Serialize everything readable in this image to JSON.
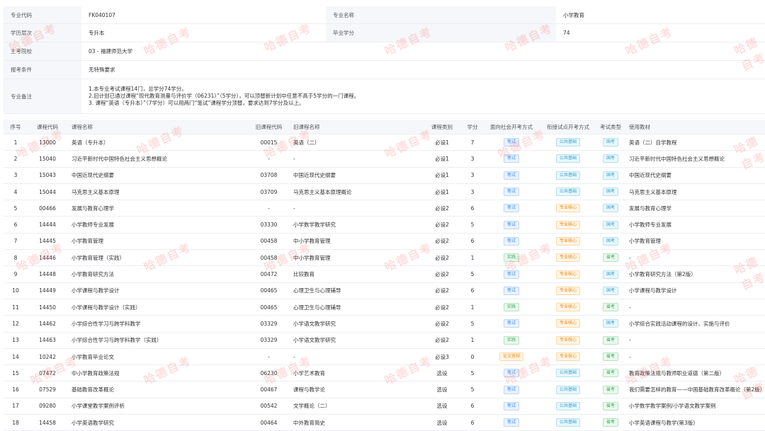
{
  "info": {
    "code_label": "专业代码",
    "code_value": "FK040107",
    "name_label": "专业名称",
    "name_value": "小学教育",
    "level_label": "学历层次",
    "level_value": "专升本",
    "credits_label": "毕业学分",
    "credits_value": "74",
    "school_label": "主考院校",
    "school_value": "03 - 福建师范大学",
    "cond_label": "报考条件",
    "cond_value": "无特殊要求",
    "notes_label": "专业备注",
    "notes": [
      "1.本专业考试课程14门，总学分74学分。",
      "2.旧计划已通过课程“现代教育测量与评价学（06231）”（5学分），可以顶替新计划中任意不高于5学分的一门课程。",
      "3. 课程“英语（专升本）”（7学分）可以用两门“笔试”课程学分顶替，要求达到7学分及以上。"
    ]
  },
  "headers": [
    "序号",
    "课程代码",
    "课程名称",
    "旧课程代码",
    "旧课程名称",
    "课程类别",
    "学分",
    "面向社会开考方式",
    "衔接试点开考方式",
    "考试类型",
    "使用教材"
  ],
  "rows": [
    {
      "no": "1",
      "code": "13000",
      "name": "英语（专升本）",
      "old_code": "00015",
      "old_name": "英语（二）",
      "cat": "必设1",
      "credit": "7",
      "social": "笔试",
      "social_c": "blue",
      "pilot": "公共基础",
      "pilot_c": "cyan",
      "exam": "国考",
      "book": "英语（二）自学教程"
    },
    {
      "no": "2",
      "code": "15040",
      "name": "习近平新时代中国特色社会主义思想概论",
      "old_code": "-",
      "old_name": "-",
      "cat": "必设1",
      "credit": "3",
      "social": "笔试",
      "social_c": "blue",
      "pilot": "公共基础",
      "pilot_c": "cyan",
      "exam": "国考",
      "book": "习近平新时代中国特色社会主义思想概论"
    },
    {
      "no": "3",
      "code": "15043",
      "name": "中国近现代史纲要",
      "old_code": "03708",
      "old_name": "中国近现代史纲要",
      "cat": "必设1",
      "credit": "3",
      "social": "笔试",
      "social_c": "blue",
      "pilot": "公共基础",
      "pilot_c": "cyan",
      "exam": "国考",
      "book": "中国近现代史纲要"
    },
    {
      "no": "4",
      "code": "15044",
      "name": "马克思主义基本原理",
      "old_code": "03709",
      "old_name": "马克思主义基本原理概论",
      "cat": "必设1",
      "credit": "3",
      "social": "笔试",
      "social_c": "blue",
      "pilot": "公共基础",
      "pilot_c": "cyan",
      "exam": "国考",
      "book": "马克思主义基本原理"
    },
    {
      "no": "5",
      "code": "00466",
      "name": "发展与教育心理学",
      "old_code": "-",
      "old_name": "-",
      "cat": "必设2",
      "credit": "6",
      "social": "笔试",
      "social_c": "blue",
      "pilot": "专业核心",
      "pilot_c": "orange",
      "exam": "国考",
      "book": "发展与教育心理学"
    },
    {
      "no": "6",
      "code": "14444",
      "name": "小学教师专业发展",
      "old_code": "03330",
      "old_name": "小学数学教学研究",
      "cat": "必设2",
      "credit": "5",
      "social": "笔试",
      "social_c": "blue",
      "pilot": "专业核心",
      "pilot_c": "orange",
      "exam": "国考",
      "book": "小学教师专业发展"
    },
    {
      "no": "7",
      "code": "14445",
      "name": "小学教育管理",
      "old_code": "00458",
      "old_name": "中小学教育管理",
      "cat": "必设2",
      "credit": "6",
      "social": "笔试",
      "social_c": "blue",
      "pilot": "专业核心",
      "pilot_c": "orange",
      "exam": "国考",
      "book": "小学教育管理"
    },
    {
      "no": "8",
      "code": "14446",
      "name": "小学教育管理（实践）",
      "old_code": "00458",
      "old_name": "中小学教育管理",
      "cat": "必设2",
      "credit": "1",
      "social": "实践",
      "social_c": "green",
      "pilot": "专业核心",
      "pilot_c": "orange",
      "exam": "省考",
      "book": "-"
    },
    {
      "no": "9",
      "code": "14448",
      "name": "小学教育研究方法",
      "old_code": "00472",
      "old_name": "比较教育",
      "cat": "必设2",
      "credit": "5",
      "social": "笔试",
      "social_c": "blue",
      "pilot": "专业核心",
      "pilot_c": "orange",
      "exam": "国考",
      "book": "小学教育研究方法（第2版）"
    },
    {
      "no": "10",
      "code": "14449",
      "name": "小学课程与教学设计",
      "old_code": "00465",
      "old_name": "心理卫生与心理辅导",
      "cat": "必设2",
      "credit": "6",
      "social": "笔试",
      "social_c": "blue",
      "pilot": "专业核心",
      "pilot_c": "orange",
      "exam": "国考",
      "book": "小学课程与教学设计"
    },
    {
      "no": "11",
      "code": "14450",
      "name": "小学课程与教学设计（实践）",
      "old_code": "00465",
      "old_name": "心理卫生与心理辅导",
      "cat": "必设2",
      "credit": "1",
      "social": "实践",
      "social_c": "green",
      "pilot": "专业核心",
      "pilot_c": "orange",
      "exam": "省考",
      "book": "-"
    },
    {
      "no": "12",
      "code": "14462",
      "name": "小学综合性学习与跨学科教学",
      "old_code": "03329",
      "old_name": "小学语文教学研究",
      "cat": "必设2",
      "credit": "5",
      "social": "笔试",
      "social_c": "blue",
      "pilot": "专业核心",
      "pilot_c": "orange",
      "exam": "国考",
      "book": "小学综合实践活动课程的设计、实施与评价"
    },
    {
      "no": "13",
      "code": "14463",
      "name": "小学综合性学习与跨学科教学（实践）",
      "old_code": "03329",
      "old_name": "小学语文教学研究",
      "cat": "必设2",
      "credit": "1",
      "social": "实践",
      "social_c": "green",
      "pilot": "专业核心",
      "pilot_c": "orange",
      "exam": "省考",
      "book": "-"
    },
    {
      "no": "14",
      "code": "10242",
      "name": "小学教育毕业论文",
      "old_code": "-",
      "old_name": "-",
      "cat": "必设3",
      "credit": "0",
      "social": "论文答辩",
      "social_c": "orange",
      "pilot": "专业核心",
      "pilot_c": "orange",
      "exam": "省考",
      "book": "-"
    },
    {
      "no": "15",
      "code": "07472",
      "name": "中小学教育政策法规",
      "old_code": "06230",
      "old_name": "小学艺术教育",
      "cat": "选设",
      "credit": "5",
      "social": "笔试",
      "social_c": "blue",
      "pilot": "公共基础",
      "pilot_c": "cyan",
      "exam": "省考",
      "book": "教育政策法规与教师职业道德（第二版）"
    },
    {
      "no": "16",
      "code": "07529",
      "name": "基础教育改革概论",
      "old_code": "00467",
      "old_name": "课程与教学论",
      "cat": "选设",
      "credit": "5",
      "social": "笔试",
      "social_c": "blue",
      "pilot": "公共基础",
      "pilot_c": "cyan",
      "exam": "省考",
      "book": "我们需要怎样的教育——中国基础教育改革概论（第2版）"
    },
    {
      "no": "17",
      "code": "09280",
      "name": "小学课堂教学案例评析",
      "old_code": "00542",
      "old_name": "文学概论（二）",
      "cat": "选设",
      "credit": "6",
      "social": "笔试",
      "social_c": "blue",
      "pilot": "公共基础",
      "pilot_c": "cyan",
      "exam": "省考",
      "book": "小学数学教学案例/小学语文教学案例"
    },
    {
      "no": "18",
      "code": "14458",
      "name": "小学英语教学研究",
      "old_code": "00464",
      "old_name": "中外教育简史",
      "cat": "选设",
      "credit": "6",
      "social": "笔试",
      "social_c": "blue",
      "pilot": "公共基础",
      "pilot_c": "cyan",
      "exam": "省考",
      "book": "小学英语课程与教学(第3版)"
    }
  ],
  "watermark": "哈德自考"
}
